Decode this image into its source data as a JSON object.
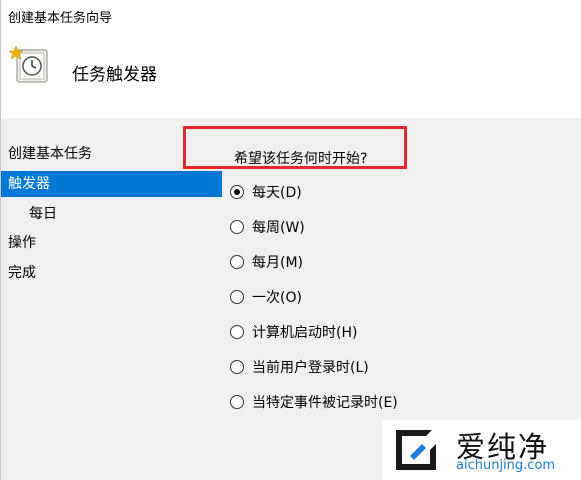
{
  "window": {
    "title": "创建基本任务向导"
  },
  "header": {
    "title": "任务触发器"
  },
  "sidebar": {
    "items": [
      {
        "label": "创建基本任务"
      },
      {
        "label": "触发器"
      },
      {
        "label": "每日"
      },
      {
        "label": "操作"
      },
      {
        "label": "完成"
      }
    ]
  },
  "main": {
    "question": "希望该任务何时开始?",
    "options": [
      {
        "label": "每天(D)",
        "checked": true
      },
      {
        "label": "每周(W)",
        "checked": false
      },
      {
        "label": "每月(M)",
        "checked": false
      },
      {
        "label": "一次(O)",
        "checked": false
      },
      {
        "label": "计算机启动时(H)",
        "checked": false
      },
      {
        "label": "当前用户登录时(L)",
        "checked": false
      },
      {
        "label": "当特定事件被记录时(E)",
        "checked": false
      }
    ]
  },
  "watermark": {
    "name": "爱纯净",
    "url": "aichunjing.com"
  },
  "colors": {
    "selection": "#0078d7",
    "highlight_box": "#e8262c",
    "panel_bg": "#f0f0f0"
  }
}
